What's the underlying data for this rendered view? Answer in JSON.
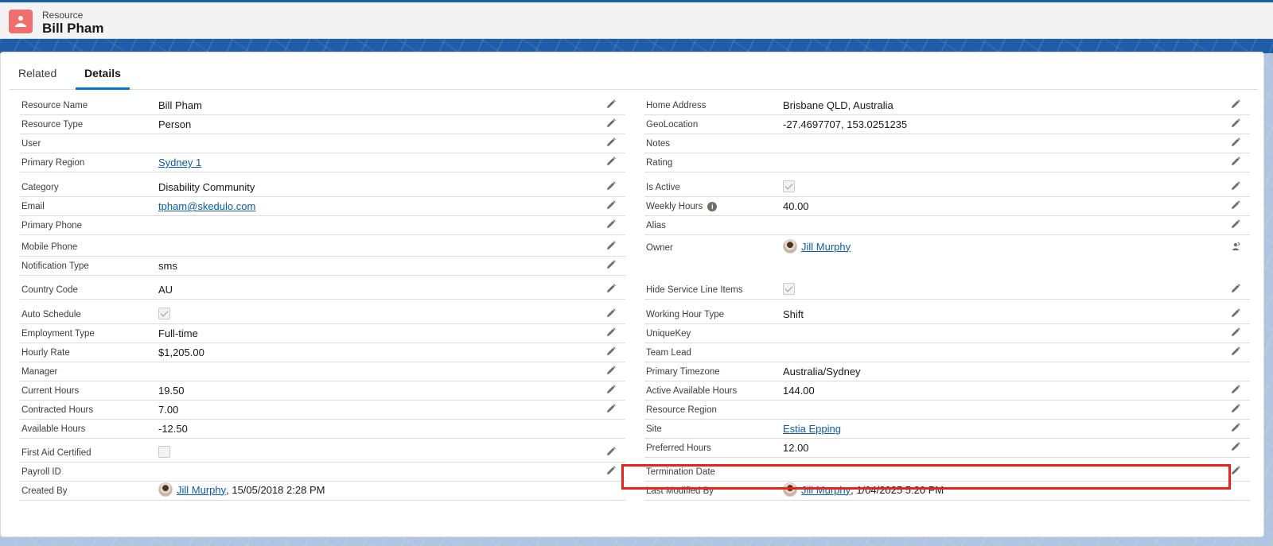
{
  "header": {
    "object_type": "Resource",
    "record_name": "Bill Pham"
  },
  "tabs": [
    {
      "label": "Related"
    },
    {
      "label": "Details",
      "active": true
    }
  ],
  "left_fields": [
    {
      "label": "Resource Name",
      "value": "Bill Pham"
    },
    {
      "label": "Resource Type",
      "value": "Person"
    },
    {
      "label": "User",
      "value": ""
    },
    {
      "label": "Primary Region",
      "value": "Sydney 1",
      "link": true
    },
    {
      "label": "Category",
      "value": "Disability Community"
    },
    {
      "label": "Email",
      "value": "tpham@skedulo.com",
      "link": true
    },
    {
      "label": "Primary Phone",
      "value": ""
    },
    {
      "label": "Mobile Phone",
      "value": ""
    },
    {
      "label": "Notification Type",
      "value": "sms"
    },
    {
      "label": "Country Code",
      "value": "AU"
    },
    {
      "label": "Auto Schedule",
      "checkbox": true
    },
    {
      "label": "Employment Type",
      "value": "Full-time"
    },
    {
      "label": "Hourly Rate",
      "value": "$1,205.00"
    },
    {
      "label": "Manager",
      "value": ""
    },
    {
      "label": "Current Hours",
      "value": "19.50"
    },
    {
      "label": "Contracted Hours",
      "value": "7.00"
    },
    {
      "label": "Available Hours",
      "value": "-12.50"
    },
    {
      "label": "First Aid Certified",
      "checkbox": false
    },
    {
      "label": "Payroll ID",
      "value": ""
    },
    {
      "label": "Created By",
      "user": "Jill Murphy",
      "suffix": ", 15/05/2018 2:28 PM"
    }
  ],
  "right_fields": [
    {
      "label": "Home Address",
      "value": "Brisbane QLD, Australia"
    },
    {
      "label": "GeoLocation",
      "value": "-27.4697707, 153.0251235"
    },
    {
      "label": "Notes",
      "value": ""
    },
    {
      "label": "Rating",
      "value": ""
    },
    {
      "label": "Is Active",
      "checkbox": true
    },
    {
      "label": "Weekly Hours",
      "value": "40.00",
      "info": true
    },
    {
      "label": "Alias",
      "value": ""
    },
    {
      "label": "Owner",
      "user": "Jill Murphy",
      "suffix": ""
    },
    {
      "label": "Hide Service Line Items",
      "checkbox": true
    },
    {
      "label": "Working Hour Type",
      "value": "Shift"
    },
    {
      "label": "UniqueKey",
      "value": ""
    },
    {
      "label": "Team Lead",
      "value": ""
    },
    {
      "label": "Primary Timezone",
      "value": "Australia/Sydney"
    },
    {
      "label": "Active Available Hours",
      "value": "144.00"
    },
    {
      "label": "Resource Region",
      "value": ""
    },
    {
      "label": "Site",
      "value": "Estia Epping",
      "link": true
    },
    {
      "label": "Preferred Hours",
      "value": "12.00"
    },
    {
      "label": "Termination Date",
      "value": ""
    },
    {
      "label": "Last Modified By",
      "user": "Jill Murphy",
      "suffix": ", 1/04/2025 5:20 PM"
    }
  ],
  "colors": {
    "accent": "#0176d3",
    "link": "#0b5cab",
    "icon_bg": "#ef6e6e",
    "highlight": "#e8231a"
  },
  "icons": {
    "object": "resource-icon",
    "edit": "pencil-icon",
    "owner_change": "change-owner-icon",
    "info": "info-icon"
  }
}
